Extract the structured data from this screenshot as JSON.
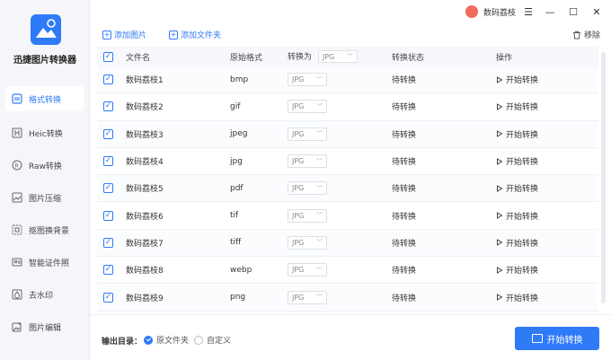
{
  "app": {
    "name": "迅捷图片转换器"
  },
  "sidebar": {
    "items": [
      {
        "label": "格式转换",
        "icon": "format-convert-icon"
      },
      {
        "label": "Heic转换",
        "icon": "heic-icon"
      },
      {
        "label": "Raw转换",
        "icon": "raw-icon"
      },
      {
        "label": "图片压缩",
        "icon": "compress-icon"
      },
      {
        "label": "抠图换背景",
        "icon": "cutout-icon"
      },
      {
        "label": "智能证件照",
        "icon": "id-photo-icon"
      },
      {
        "label": "去水印",
        "icon": "watermark-icon"
      },
      {
        "label": "图片编辑",
        "icon": "edit-icon"
      }
    ]
  },
  "titlebar": {
    "user": "数码荔枝"
  },
  "toolbar": {
    "add_image": "添加图片",
    "add_folder": "添加文件夹",
    "remove": "移除"
  },
  "table": {
    "headers": {
      "name": "文件名",
      "format": "原始格式",
      "convert_to": "转换为",
      "status": "转换状态",
      "action": "操作"
    },
    "header_select": "JPG",
    "rows": [
      {
        "name": "数码荔枝1",
        "format": "bmp",
        "target": "JPG",
        "status": "待转换",
        "action": "开始转换"
      },
      {
        "name": "数码荔枝2",
        "format": "gif",
        "target": "JPG",
        "status": "待转换",
        "action": "开始转换"
      },
      {
        "name": "数码荔枝3",
        "format": "jpeg",
        "target": "JPG",
        "status": "待转换",
        "action": "开始转换"
      },
      {
        "name": "数码荔枝4",
        "format": "jpg",
        "target": "JPG",
        "status": "待转换",
        "action": "开始转换"
      },
      {
        "name": "数码荔枝5",
        "format": "pdf",
        "target": "JPG",
        "status": "待转换",
        "action": "开始转换"
      },
      {
        "name": "数码荔枝6",
        "format": "tif",
        "target": "JPG",
        "status": "待转换",
        "action": "开始转换"
      },
      {
        "name": "数码荔枝7",
        "format": "tiff",
        "target": "JPG",
        "status": "待转换",
        "action": "开始转换"
      },
      {
        "name": "数码荔枝8",
        "format": "webp",
        "target": "JPG",
        "status": "待转换",
        "action": "开始转换"
      },
      {
        "name": "数码荔枝9",
        "format": "png",
        "target": "JPG",
        "status": "待转换",
        "action": "开始转换"
      }
    ]
  },
  "footer": {
    "output_label": "输出目录：",
    "option_original": "原文件夹",
    "option_custom": "自定义",
    "start_button": "开始转换"
  },
  "colors": {
    "accent": "#2f7af7"
  }
}
